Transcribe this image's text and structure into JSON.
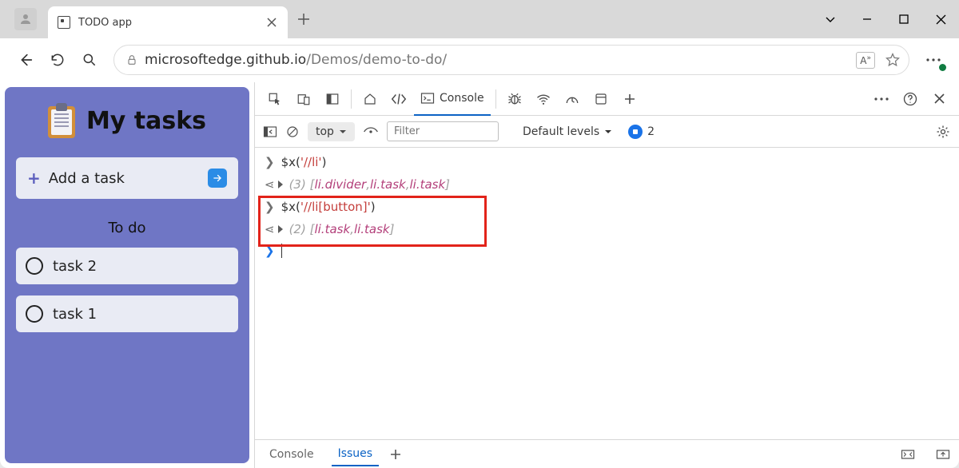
{
  "browser": {
    "tab_title": "TODO app",
    "url_host": "microsoftedge.github.io",
    "url_path": "/Demos/demo-to-do/"
  },
  "app": {
    "heading": "My tasks",
    "add_label": "Add a task",
    "section_label": "To do",
    "tasks": [
      "task 2",
      "task 1"
    ]
  },
  "devtools": {
    "active_tab": "Console",
    "context_label": "top",
    "filter_placeholder": "Filter",
    "levels_label": "Default levels",
    "issues_count": "2",
    "console": {
      "entries": [
        {
          "type": "input",
          "prefix": "$x(",
          "str": "'//li'",
          "suffix": ")"
        },
        {
          "type": "output",
          "count": "(3)",
          "items": [
            "li.divider",
            "li.task",
            "li.task"
          ]
        },
        {
          "type": "input",
          "prefix": "$x(",
          "str": "'//li[button]'",
          "suffix": ")"
        },
        {
          "type": "output",
          "count": "(2)",
          "items": [
            "li.task",
            "li.task"
          ]
        }
      ]
    },
    "drawer": {
      "tab1": "Console",
      "tab2": "Issues"
    }
  }
}
